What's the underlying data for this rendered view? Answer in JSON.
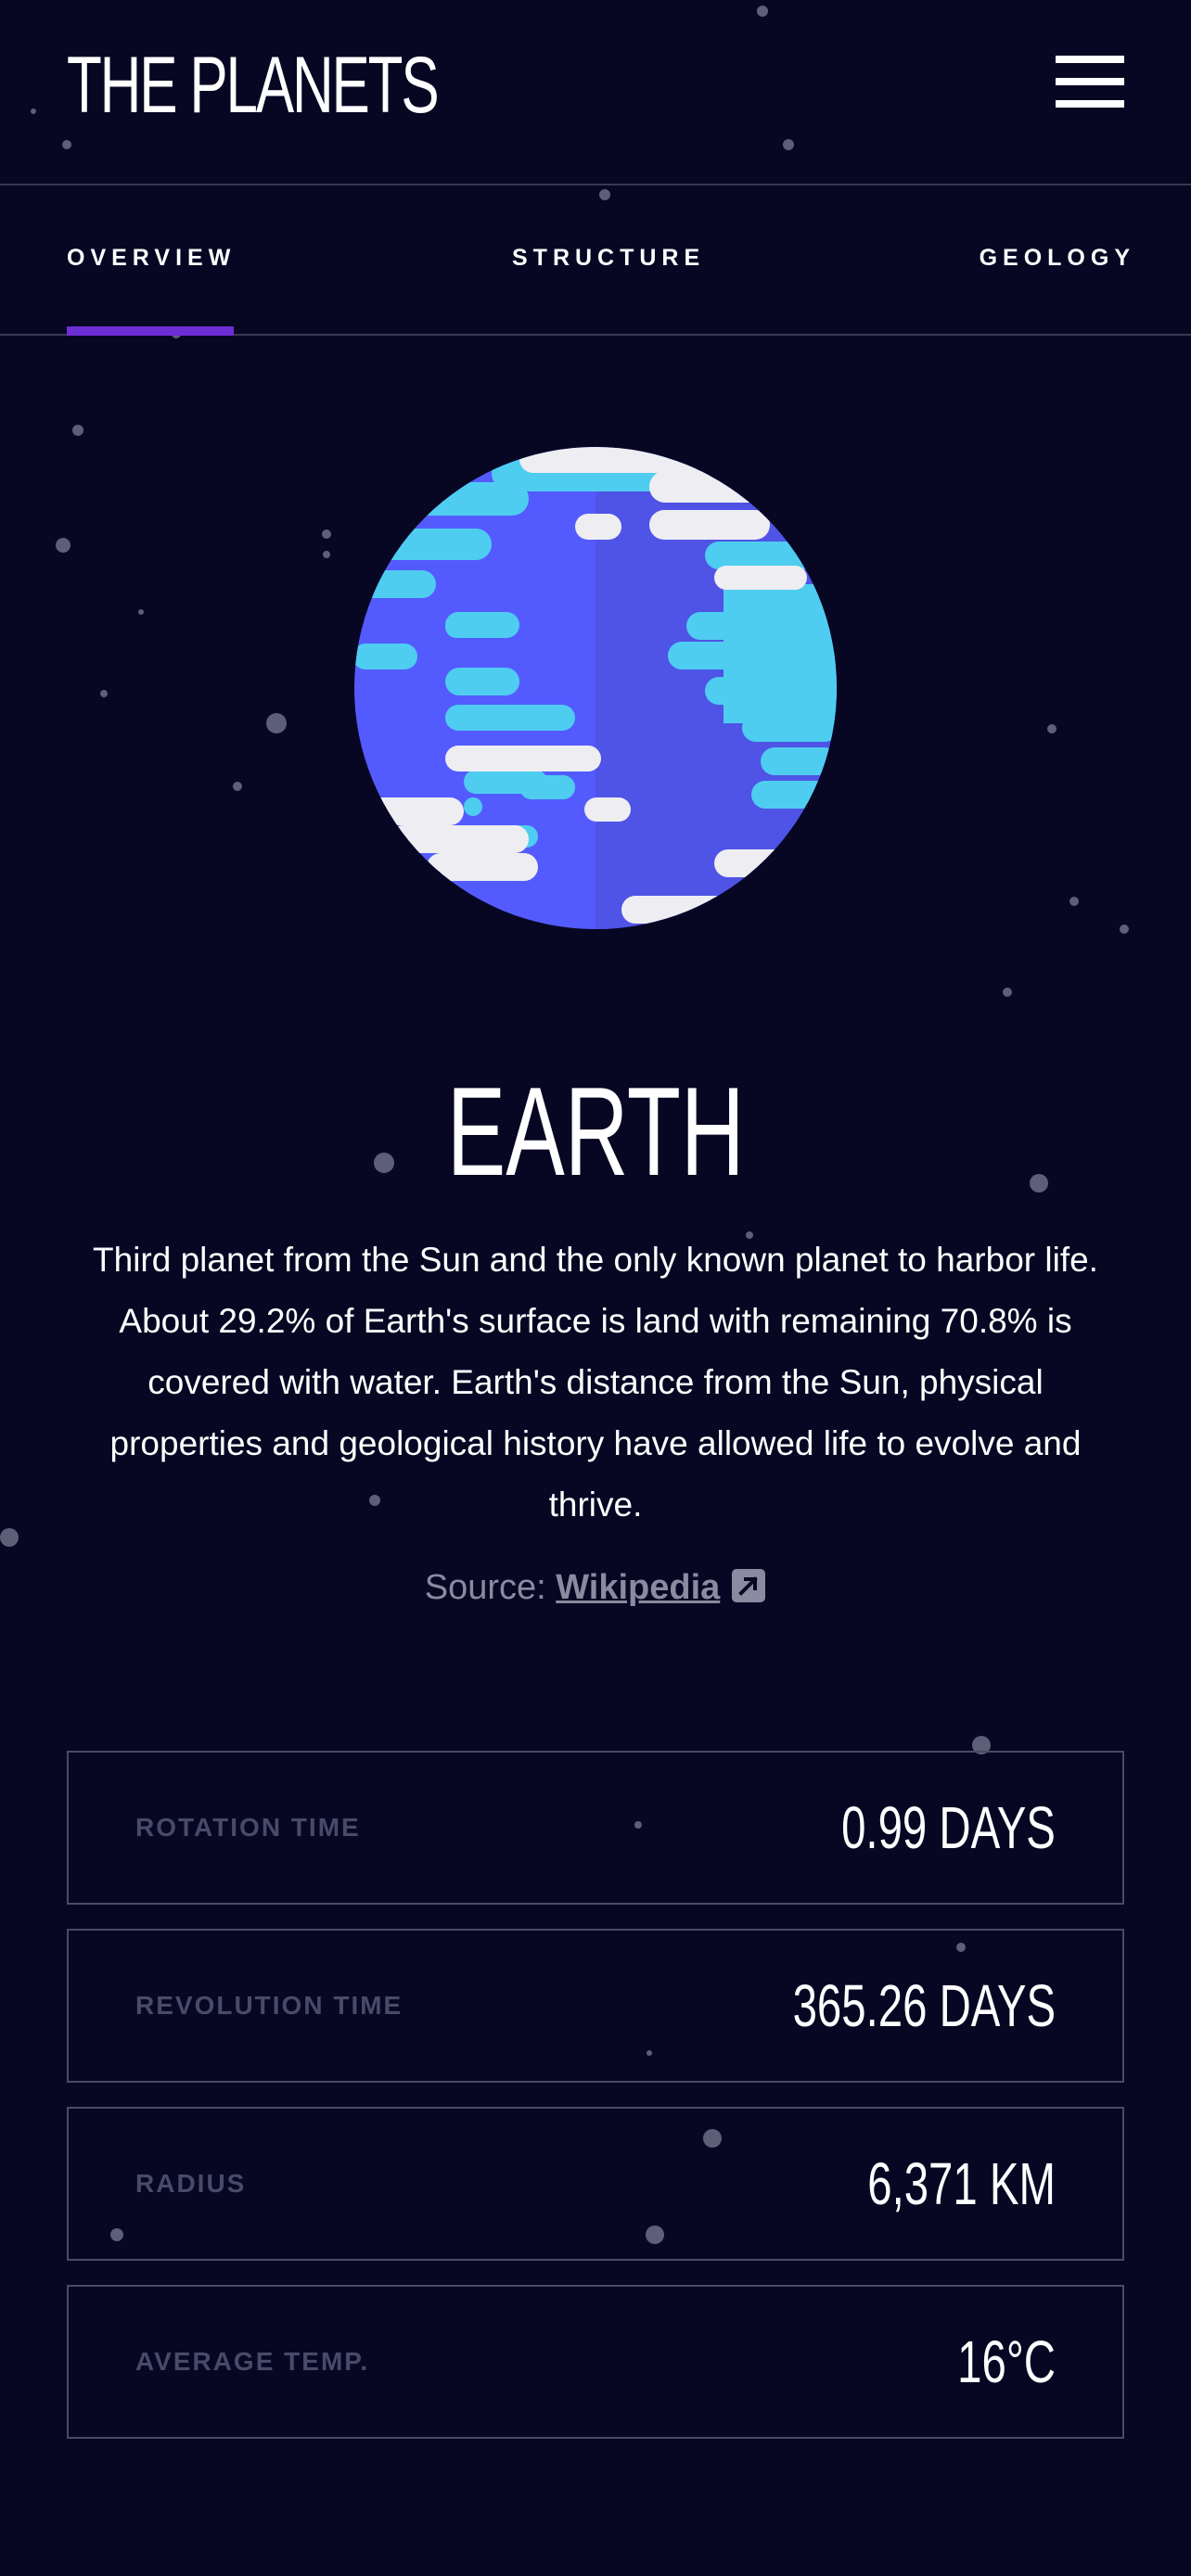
{
  "header": {
    "logo": "THE PLANETS",
    "menu_icon": "hamburger-menu-icon"
  },
  "tabs": [
    {
      "label": "OVERVIEW",
      "active": true
    },
    {
      "label": "STRUCTURE",
      "active": false
    },
    {
      "label": "GEOLOGY",
      "active": false
    }
  ],
  "planet": {
    "name": "EARTH",
    "description": "Third planet from the Sun and the only known planet to harbor life. About 29.2% of Earth's surface is land with remaining 70.8% is covered with water. Earth's distance from the Sun, physical properties and geological history have allowed life to evolve and thrive.",
    "source_prefix": "Source: ",
    "source_link": "Wikipedia",
    "source_icon": "external-link-icon"
  },
  "stats": [
    {
      "label": "ROTATION TIME",
      "value": "0.99 DAYS"
    },
    {
      "label": "REVOLUTION TIME",
      "value": "365.26 DAYS"
    },
    {
      "label": "RADIUS",
      "value": "6,371 KM"
    },
    {
      "label": "AVERAGE TEMP.",
      "value": "16°C"
    }
  ],
  "colors": {
    "background": "#070724",
    "accent": "#6d2ed5",
    "border": "#38384f",
    "stat_label": "#484a69",
    "earth_blue": "#545bfe",
    "earth_cyan": "#4ecdf0",
    "earth_white": "#eeeef2"
  }
}
